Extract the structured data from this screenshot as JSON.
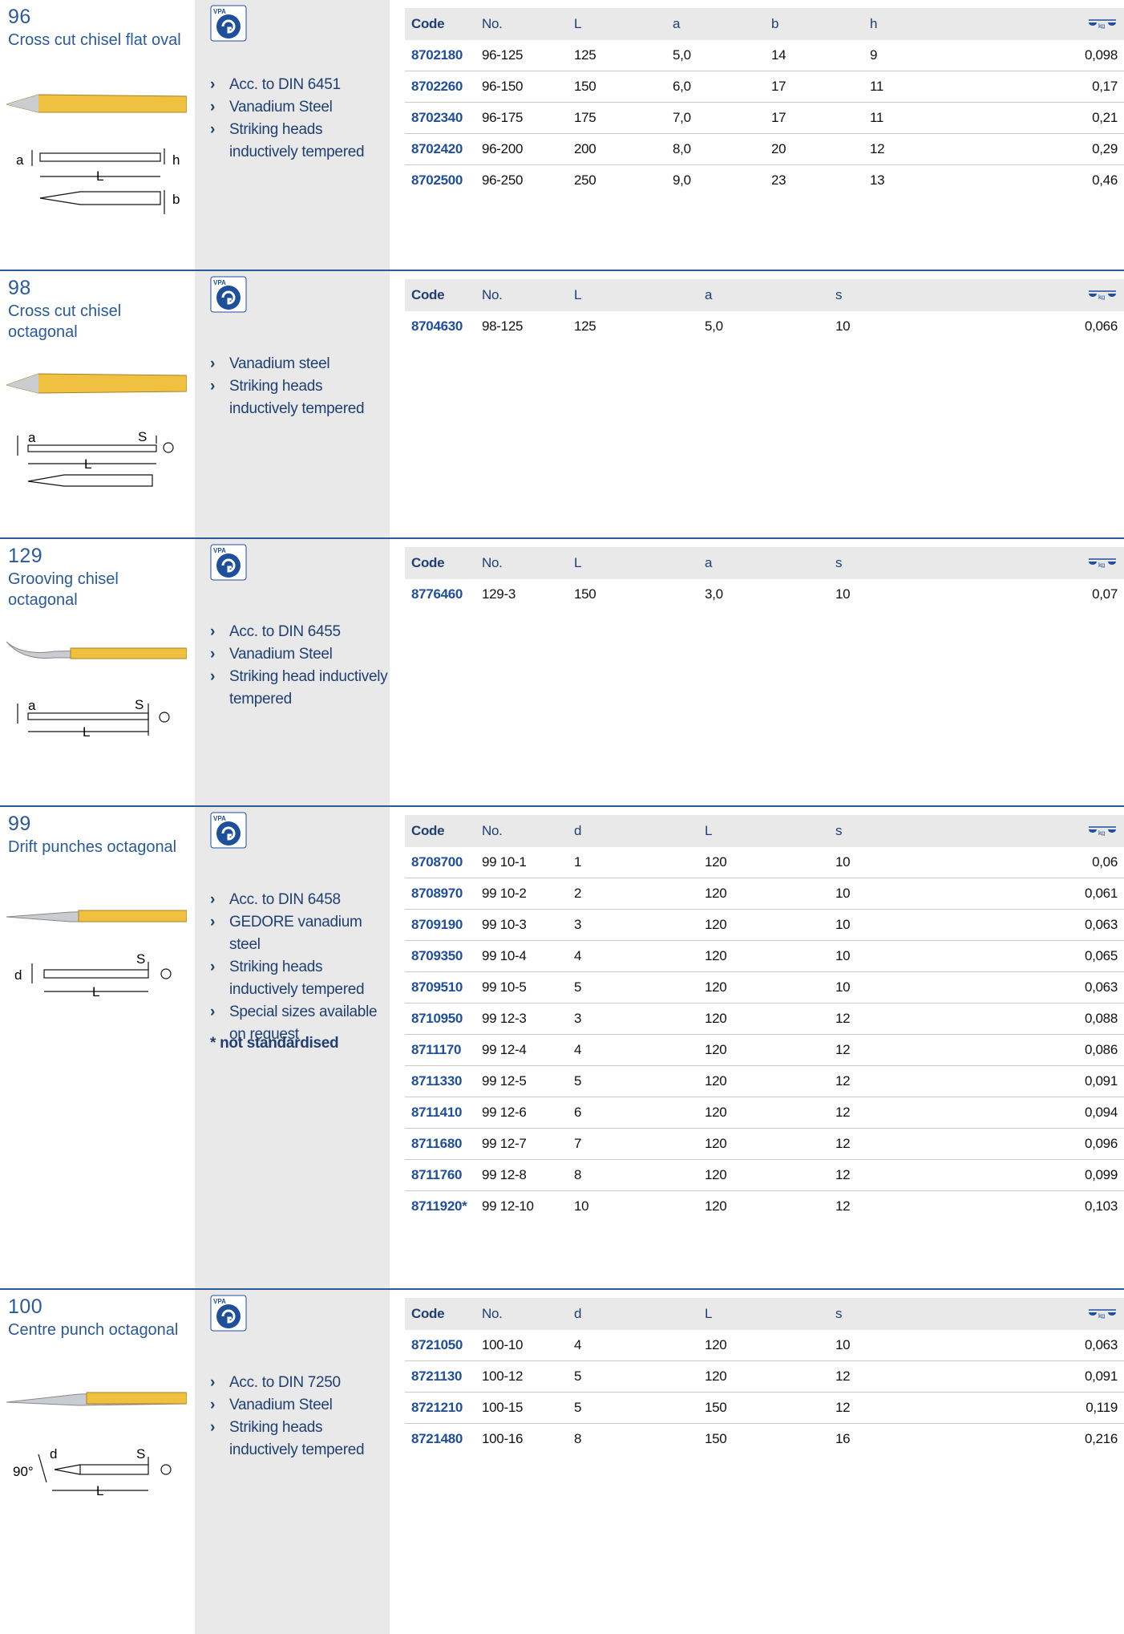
{
  "sections": [
    {
      "number": "96",
      "title": "Cross cut chisel flat oval",
      "features": [
        "Acc. to DIN 6451",
        "Vanadium Steel",
        "Striking heads inductively tempered"
      ],
      "note": "",
      "headers": [
        "Code",
        "No.",
        "L",
        "a",
        "b",
        "h"
      ],
      "rows": [
        [
          "8702180",
          "96-125",
          "125",
          "5,0",
          "14",
          "9",
          "0,098"
        ],
        [
          "8702260",
          "96-150",
          "150",
          "6,0",
          "17",
          "11",
          "0,17"
        ],
        [
          "8702340",
          "96-175",
          "175",
          "7,0",
          "17",
          "11",
          "0,21"
        ],
        [
          "8702420",
          "96-200",
          "200",
          "8,0",
          "20",
          "12",
          "0,29"
        ],
        [
          "8702500",
          "96-250",
          "250",
          "9,0",
          "23",
          "13",
          "0,46"
        ]
      ],
      "drawing_labels": [
        "a",
        "h",
        "L",
        "b"
      ]
    },
    {
      "number": "98",
      "title": "Cross cut chisel octagonal",
      "features": [
        "Vanadium steel",
        "Striking heads inductively tempered"
      ],
      "note": "",
      "headers": [
        "Code",
        "No.",
        "L",
        "a",
        "s"
      ],
      "rows": [
        [
          "8704630",
          "98-125",
          "125",
          "5,0",
          "10",
          "0,066"
        ]
      ],
      "drawing_labels": [
        "a",
        "S",
        "L"
      ]
    },
    {
      "number": "129",
      "title": "Grooving chisel octagonal",
      "features": [
        "Acc. to DIN 6455",
        "Vanadium Steel",
        "Striking head inductively tempered"
      ],
      "note": "",
      "headers": [
        "Code",
        "No.",
        "L",
        "a",
        "s"
      ],
      "rows": [
        [
          "8776460",
          "129-3",
          "150",
          "3,0",
          "10",
          "0,07"
        ]
      ],
      "drawing_labels": [
        "a",
        "S",
        "L"
      ]
    },
    {
      "number": "99",
      "title": "Drift punches octagonal",
      "features": [
        "Acc. to DIN 6458",
        "GEDORE vanadium steel",
        "Striking heads inductively tempered",
        "Special sizes available on request"
      ],
      "note": "* not standardised",
      "headers": [
        "Code",
        "No.",
        "d",
        "L",
        "s"
      ],
      "rows": [
        [
          "8708700",
          "99 10-1",
          "1",
          "120",
          "10",
          "0,06"
        ],
        [
          "8708970",
          "99 10-2",
          "2",
          "120",
          "10",
          "0,061"
        ],
        [
          "8709190",
          "99 10-3",
          "3",
          "120",
          "10",
          "0,063"
        ],
        [
          "8709350",
          "99 10-4",
          "4",
          "120",
          "10",
          "0,065"
        ],
        [
          "8709510",
          "99 10-5",
          "5",
          "120",
          "10",
          "0,063"
        ],
        [
          "8710950",
          "99 12-3",
          "3",
          "120",
          "12",
          "0,088"
        ],
        [
          "8711170",
          "99 12-4",
          "4",
          "120",
          "12",
          "0,086"
        ],
        [
          "8711330",
          "99 12-5",
          "5",
          "120",
          "12",
          "0,091"
        ],
        [
          "8711410",
          "99 12-6",
          "6",
          "120",
          "12",
          "0,094"
        ],
        [
          "8711680",
          "99 12-7",
          "7",
          "120",
          "12",
          "0,096"
        ],
        [
          "8711760",
          "99 12-8",
          "8",
          "120",
          "12",
          "0,099"
        ],
        [
          "8711920*",
          "99 12-10",
          "10",
          "120",
          "12",
          "0,103"
        ]
      ],
      "drawing_labels": [
        "d",
        "S",
        "L"
      ]
    },
    {
      "number": "100",
      "title": "Centre punch octagonal",
      "features": [
        "Acc. to DIN 7250",
        "Vanadium Steel",
        "Striking heads inductively tempered"
      ],
      "note": "",
      "headers": [
        "Code",
        "No.",
        "d",
        "L",
        "s"
      ],
      "rows": [
        [
          "8721050",
          "100-10",
          "4",
          "120",
          "10",
          "0,063"
        ],
        [
          "8721130",
          "100-12",
          "5",
          "120",
          "12",
          "0,091"
        ],
        [
          "8721210",
          "100-15",
          "5",
          "150",
          "12",
          "0,119"
        ],
        [
          "8721480",
          "100-16",
          "8",
          "150",
          "16",
          "0,216"
        ]
      ],
      "drawing_labels": [
        "d",
        "90°",
        "S",
        "L"
      ]
    }
  ],
  "weight_icon": "scale-kg-icon",
  "weight_icon_label": "kg",
  "gs_logo_text": "VPA",
  "colors": {
    "accent": "#2a5a9a",
    "code": "#1f4f9a",
    "panel": "#e9e9e9",
    "tool_yellow": "#f0c040"
  }
}
